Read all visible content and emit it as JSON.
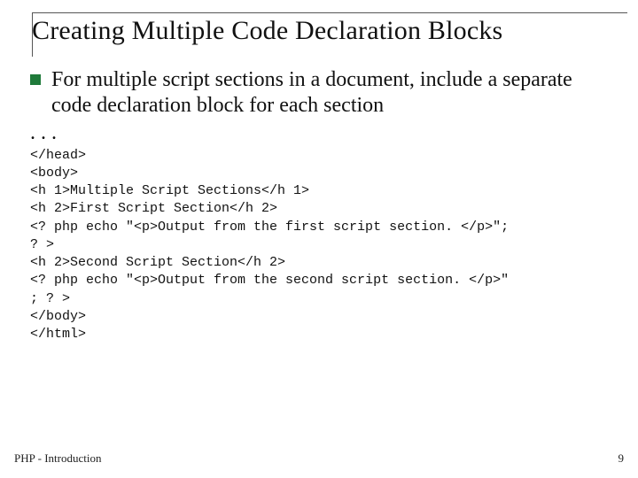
{
  "title": "Creating Multiple Code Declaration Blocks",
  "bullet": "For multiple script sections in a document, include a separate code declaration block for each section",
  "ellipsis": ". . .",
  "code_lines": [
    "</head>",
    "<body>",
    "<h 1>Multiple Script Sections</h 1>",
    "<h 2>First Script Section</h 2>",
    "<? php echo \"<p>Output from the first script section. </p>\";",
    "? >",
    "<h 2>Second Script Section</h 2>",
    "<? php echo \"<p>Output from the second script section. </p>\"",
    "; ? >",
    "</body>",
    "</html>"
  ],
  "footer_left": "PHP - Introduction",
  "footer_right": "9"
}
